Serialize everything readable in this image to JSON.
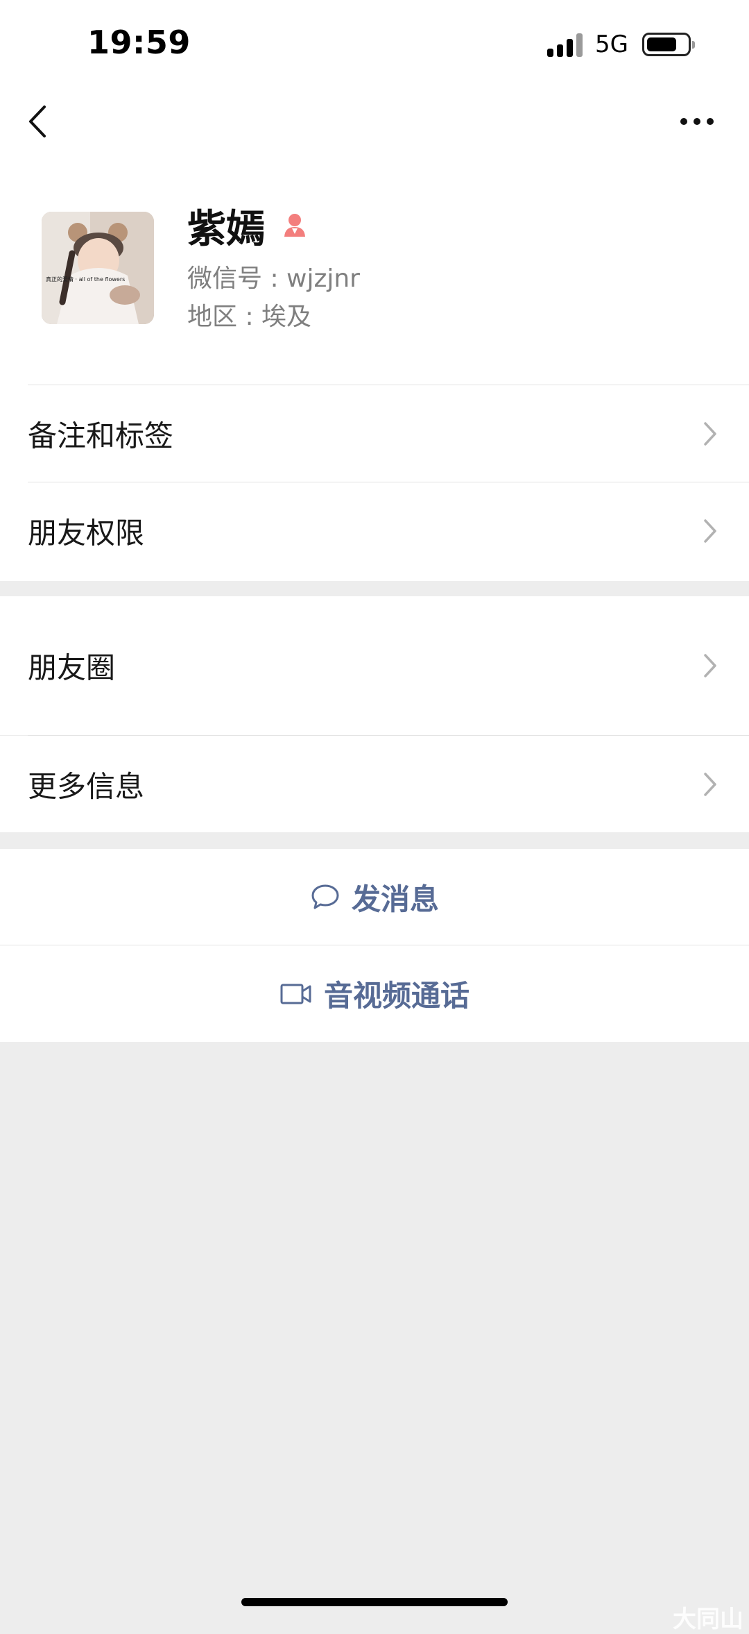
{
  "status_bar": {
    "time": "19:59",
    "network": "5G"
  },
  "nav": {
    "back_icon": "chevron-left-icon",
    "more_icon": "ellipsis-icon"
  },
  "profile": {
    "name": "紫嫣",
    "gender_icon": "female-icon",
    "gender_color": "#f37e7d",
    "wechat_id_line": "微信号 : wjzjnr",
    "region_line": "地区 : 埃及",
    "avatar_caption": "真正的爱情 · all of the flowers"
  },
  "menu": {
    "remarks_tags": "备注和标签",
    "friend_permissions": "朋友权限",
    "moments": "朋友圈",
    "more_info": "更多信息"
  },
  "actions": {
    "send_message": "发消息",
    "send_message_icon": "chat-bubble-icon",
    "video_call": "音视频通话",
    "video_call_icon": "video-camera-icon",
    "accent_color": "#576b95"
  },
  "watermark": {
    "text": "大同山"
  }
}
